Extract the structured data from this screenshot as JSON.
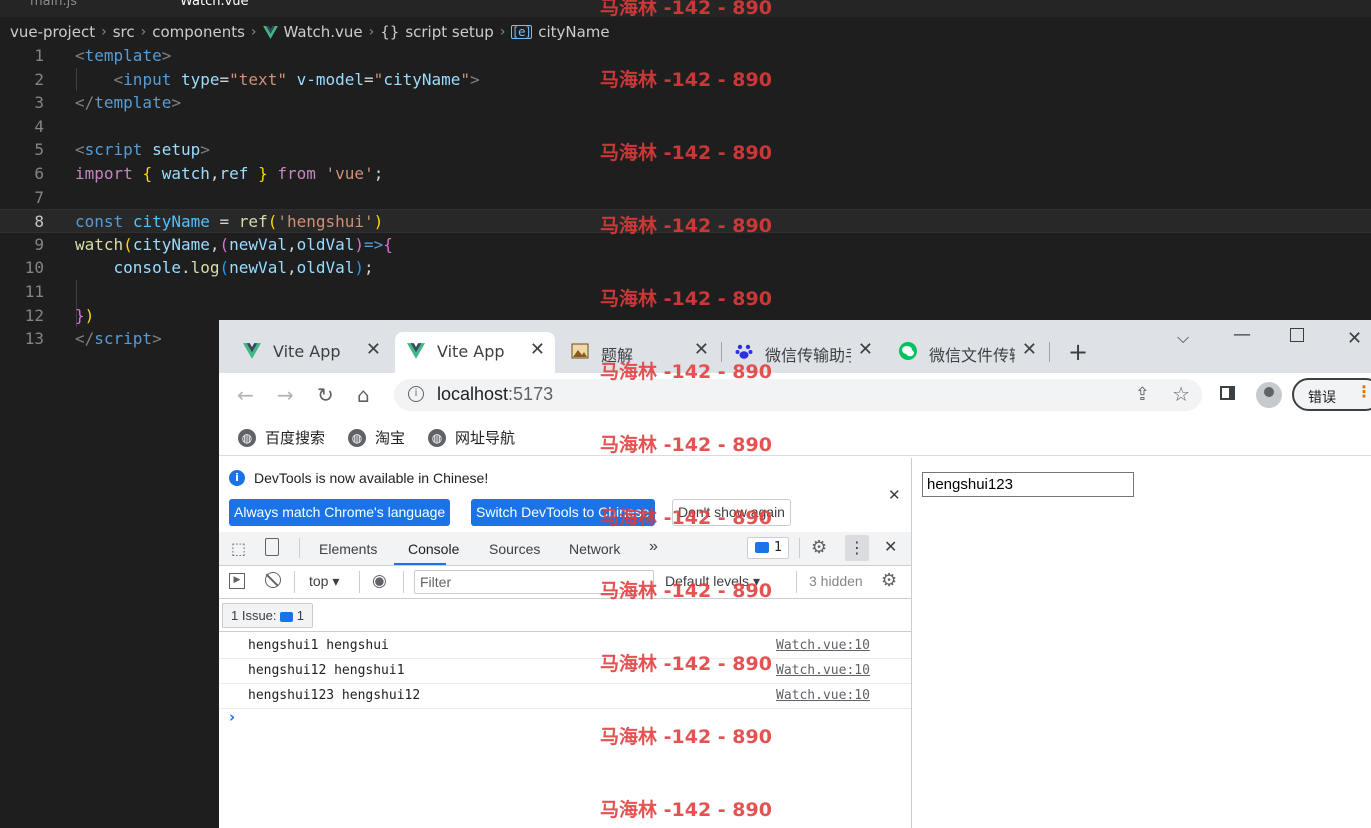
{
  "editor": {
    "tabs": [
      {
        "label": "main.js",
        "active": false
      },
      {
        "label": "Watch.vue",
        "active": true
      }
    ],
    "breadcrumb": [
      "vue-project",
      "src",
      "components",
      "Watch.vue",
      "script setup",
      "cityName"
    ],
    "current_line": 8,
    "line_numbers": [
      "1",
      "2",
      "3",
      "4",
      "5",
      "6",
      "7",
      "8",
      "9",
      "10",
      "11",
      "12",
      "13"
    ]
  },
  "browser": {
    "tabs": [
      {
        "label": "Vite App",
        "icon": "vue-icon",
        "active": false
      },
      {
        "label": "Vite App",
        "icon": "vue-icon",
        "active": true
      },
      {
        "label": "题解",
        "icon": "image-icon",
        "active": false
      },
      {
        "label": "微信传输助手",
        "icon": "baidu-paw-icon",
        "active": false
      },
      {
        "label": "微信文件传输",
        "icon": "wechat-icon",
        "active": false
      }
    ],
    "new_tab": "+",
    "url_host": "localhost",
    "url_port": ":5173",
    "error_button": "错误",
    "bookmarks": [
      "百度搜索",
      "淘宝",
      "网址导航"
    ]
  },
  "devtools": {
    "info_text": "DevTools is now available in Chinese!",
    "buttons": {
      "match": "Always match Chrome's language",
      "switch": "Switch DevTools to Chinese",
      "dismiss": "Don't show again"
    },
    "tabs": [
      "Elements",
      "Console",
      "Sources",
      "Network"
    ],
    "active_tab": "Console",
    "more_tabs": "»",
    "message_count": "1",
    "context": "top",
    "filter_placeholder": "Filter",
    "levels": "Default levels",
    "hidden": "3 hidden",
    "issues_label": "1 Issue:",
    "issues_count": "1",
    "logs": [
      {
        "message": "hengshui1 hengshui",
        "source": "Watch.vue:10"
      },
      {
        "message": "hengshui12 hengshui1",
        "source": "Watch.vue:10"
      },
      {
        "message": "hengshui123 hengshui12",
        "source": "Watch.vue:10"
      }
    ],
    "prompt": "›"
  },
  "page": {
    "input_value": "hengshui123"
  },
  "watermark": {
    "text": "马海林 -142 - 890"
  },
  "colors": {
    "editor_bg": "#1e1e1e",
    "accent": "#1a73e8",
    "watermark": "#e23b3b"
  }
}
